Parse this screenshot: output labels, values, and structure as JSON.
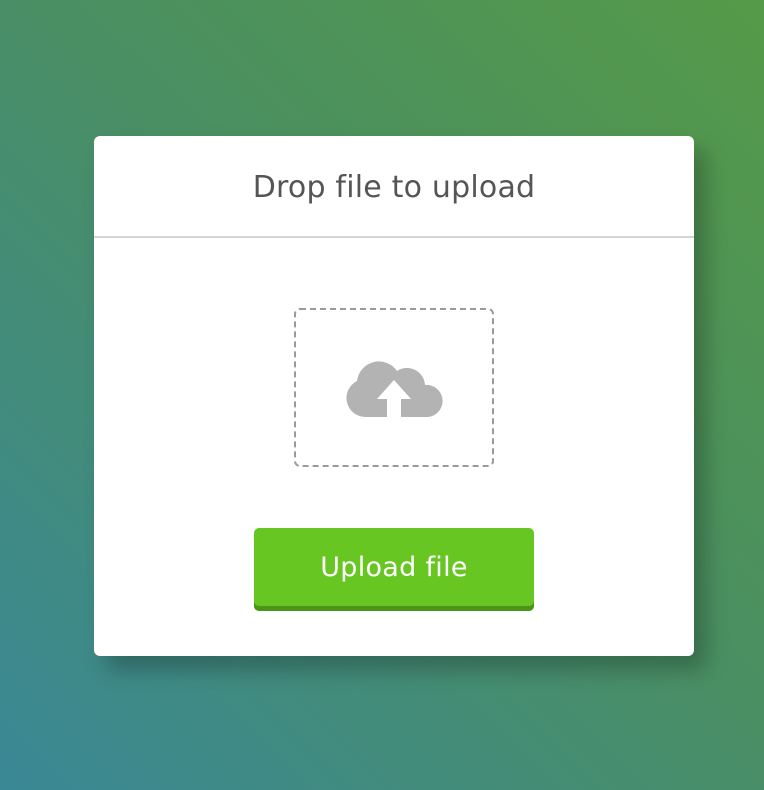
{
  "dialog": {
    "title": "Drop file to upload"
  },
  "drop_zone": {
    "icon": "cloud-upload-icon",
    "icon_color": "#b3b3b3",
    "border_color": "#9a9a9a"
  },
  "upload_button": {
    "label": "Upload file",
    "color": "#68c623",
    "shadow_color": "#4a9517"
  },
  "colors": {
    "background_gradient": [
      "#559a48",
      "#4a8f62",
      "#3a8896"
    ],
    "card": "#ffffff",
    "title_text": "#555555",
    "divider": "#d4d4d4"
  }
}
